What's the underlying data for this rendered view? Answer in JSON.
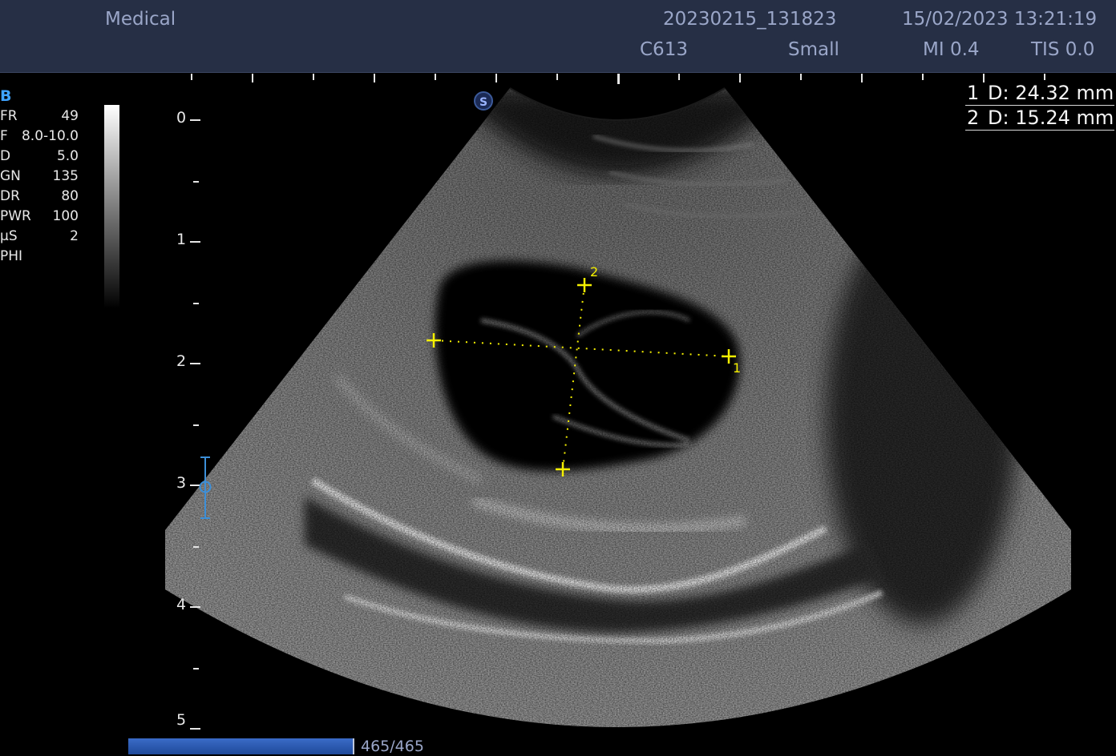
{
  "header": {
    "facility": "Medical",
    "exam_id": "20230215_131823",
    "datetime": "15/02/2023 13:21:19",
    "probe": "C613",
    "preset": "Small",
    "mi": "MI 0.4",
    "tis": "TIS 0.0"
  },
  "params": {
    "mode": "B",
    "rows": [
      {
        "key": "FR",
        "value": "49"
      },
      {
        "key": "F",
        "value": "8.0-10.0"
      },
      {
        "key": "D",
        "value": "5.0"
      },
      {
        "key": "GN",
        "value": "135"
      },
      {
        "key": "DR",
        "value": "80"
      },
      {
        "key": "PWR",
        "value": "100"
      },
      {
        "key": "µS",
        "value": "2"
      },
      {
        "key": "PHI",
        "value": ""
      }
    ]
  },
  "depth_scale": {
    "labels": [
      "0",
      "1",
      "2",
      "3",
      "4",
      "5"
    ]
  },
  "sector": {
    "orientation_marker": "S"
  },
  "calipers": {
    "caliper_1_label": "1",
    "caliper_2_label": "2"
  },
  "measurements": [
    {
      "index": "1",
      "text": "D: 24.32  mm"
    },
    {
      "index": "2",
      "text": "D: 15.24  mm"
    }
  ],
  "cine": {
    "label": "465/465",
    "current": 465,
    "total": 465
  },
  "colors": {
    "header_bg": "#262f45",
    "header_text": "#9aa6c8",
    "caliper": "#f5f000",
    "mode_accent": "#3fa3ff",
    "focus_marker": "#3c8fd8"
  }
}
